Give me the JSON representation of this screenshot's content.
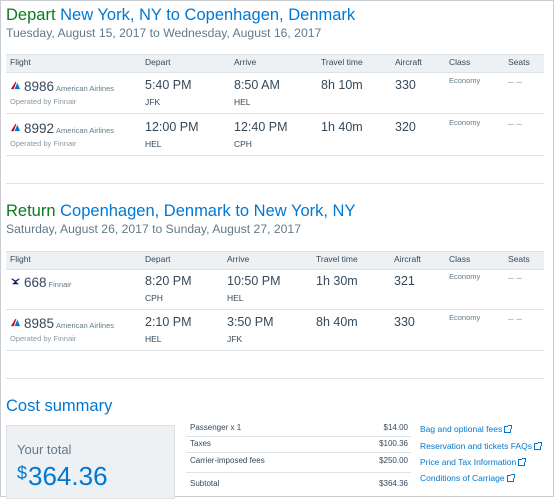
{
  "depart": {
    "keyword": "Depart",
    "route": "New York, NY to Copenhagen, Denmark",
    "dates": "Tuesday, August 15, 2017 to Wednesday, August 16, 2017",
    "headers": {
      "flight": "Flight",
      "depart": "Depart",
      "arrive": "Arrive",
      "travel": "Travel time",
      "aircraft": "Aircraft",
      "class": "Class",
      "seats": "Seats"
    },
    "flights": [
      {
        "number": "8986",
        "carrier": "American Airlines",
        "operated": "Operated by Finnair",
        "dep_time": "5:40 PM",
        "dep_ap": "JFK",
        "arr_time": "8:50 AM",
        "arr_ap": "HEL",
        "duration": "8h 10m",
        "aircraft": "330",
        "class": "Economy",
        "seats": "– –",
        "logo": "american-airlines-logo"
      },
      {
        "number": "8992",
        "carrier": "American Airlines",
        "operated": "Operated by Finnair",
        "dep_time": "12:00 PM",
        "dep_ap": "HEL",
        "arr_time": "12:40 PM",
        "arr_ap": "CPH",
        "duration": "1h 40m",
        "aircraft": "320",
        "class": "Economy",
        "seats": "– –",
        "logo": "american-airlines-logo"
      }
    ]
  },
  "return": {
    "keyword": "Return",
    "route": "Copenhagen, Denmark to New York, NY",
    "dates": "Saturday, August 26, 2017 to Sunday, August 27, 2017",
    "headers": {
      "flight": "Flight",
      "depart": "Depart",
      "arrive": "Arrive",
      "travel": "Travel time",
      "aircraft": "Aircraft",
      "class": "Class",
      "seats": "Seats"
    },
    "flights": [
      {
        "number": "668",
        "carrier": "Finnair",
        "operated": "",
        "dep_time": "8:20 PM",
        "dep_ap": "CPH",
        "arr_time": "10:50 PM",
        "arr_ap": "HEL",
        "duration": "1h 30m",
        "aircraft": "321",
        "class": "Economy",
        "seats": "– –",
        "logo": "finnair-logo"
      },
      {
        "number": "8985",
        "carrier": "American Airlines",
        "operated": "Operated by Finnair",
        "dep_time": "2:10 PM",
        "dep_ap": "HEL",
        "arr_time": "3:50 PM",
        "arr_ap": "JFK",
        "duration": "8h 40m",
        "aircraft": "330",
        "class": "Economy",
        "seats": "– –",
        "logo": "american-airlines-logo"
      }
    ]
  },
  "cost": {
    "title": "Cost summary",
    "total_label": "Your total",
    "total_currency": "$",
    "total_value": "364.36",
    "fees": [
      {
        "label": "Passenger x 1",
        "amount": "$14.00"
      },
      {
        "label": "Taxes",
        "amount": "$100.36"
      },
      {
        "label": "Carrier-imposed fees",
        "amount": "$250.00"
      },
      {
        "label": "Subtotal",
        "amount": "$364.36"
      }
    ],
    "links": [
      "Bag and optional fees",
      "Reservation and tickets FAQs",
      "Price and Tax Information",
      "Conditions of Carriage"
    ]
  },
  "colors": {
    "accent": "#0078d2",
    "keyword": "#0a7a1f",
    "aa_red": "#c30019",
    "aa_blue": "#0078d2",
    "finnair_blue": "#0b1560"
  }
}
